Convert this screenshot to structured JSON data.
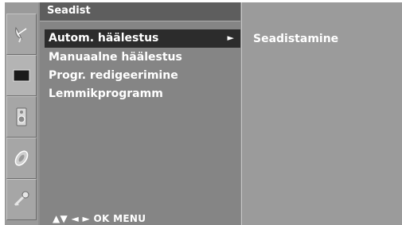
{
  "colors": {
    "selected_bg": "#2c2c2c",
    "panel_bg": "#858585",
    "title_bg": "#5e5e5e",
    "text": "#ffffff"
  },
  "icons": [
    {
      "name": "satellite-dish-icon",
      "active": false
    },
    {
      "name": "screen-icon",
      "active": true
    },
    {
      "name": "speaker-icon",
      "active": false
    },
    {
      "name": "disc-icon",
      "active": false
    },
    {
      "name": "key-icon",
      "active": false
    }
  ],
  "menu": {
    "title": "Seadist",
    "items": [
      {
        "label": "Autom. häälestus",
        "selected": true,
        "arrow": "►"
      },
      {
        "label": "Manuaalne häälestus"
      },
      {
        "label": "Progr. redigeerimine"
      },
      {
        "label": "Lemmikprogramm"
      }
    ],
    "nav_hint": "▲▼ ◄ ► OK MENU"
  },
  "submenu": {
    "label": "Seadistamine"
  }
}
